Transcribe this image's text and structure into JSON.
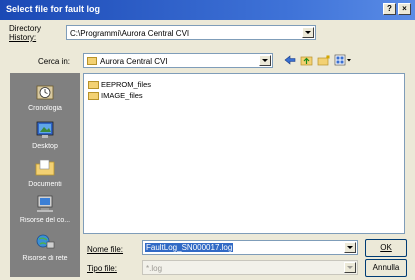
{
  "window": {
    "title": "Select file for fault log",
    "help_label": "?",
    "close_label": "×"
  },
  "directory_history": {
    "label_line1": "Directory",
    "label_line2": "History:",
    "value": "C:\\Programmi\\Aurora Central CVI"
  },
  "look_in": {
    "label": "Cerca in:",
    "value": "Aurora Central CVI"
  },
  "places": [
    {
      "label": "Cronologia",
      "icon": "history-icon"
    },
    {
      "label": "Desktop",
      "icon": "desktop-icon"
    },
    {
      "label": "Documenti",
      "icon": "documents-icon"
    },
    {
      "label": "Risorse del co...",
      "icon": "my-computer-icon"
    },
    {
      "label": "Risorse di rete",
      "icon": "network-icon"
    }
  ],
  "files": [
    {
      "name": "EEPROM_files",
      "type": "folder"
    },
    {
      "name": "IMAGE_files",
      "type": "folder"
    }
  ],
  "file_name": {
    "label": "Nome file:",
    "value": "FaultLog_SN000017.log"
  },
  "file_type": {
    "label": "Tipo file:",
    "value": "*.log"
  },
  "buttons": {
    "ok": "OK",
    "cancel": "Annulla"
  },
  "colors": {
    "title_bar": "#1b49b5",
    "places_bg": "#808080",
    "selection": "#316ac5"
  }
}
